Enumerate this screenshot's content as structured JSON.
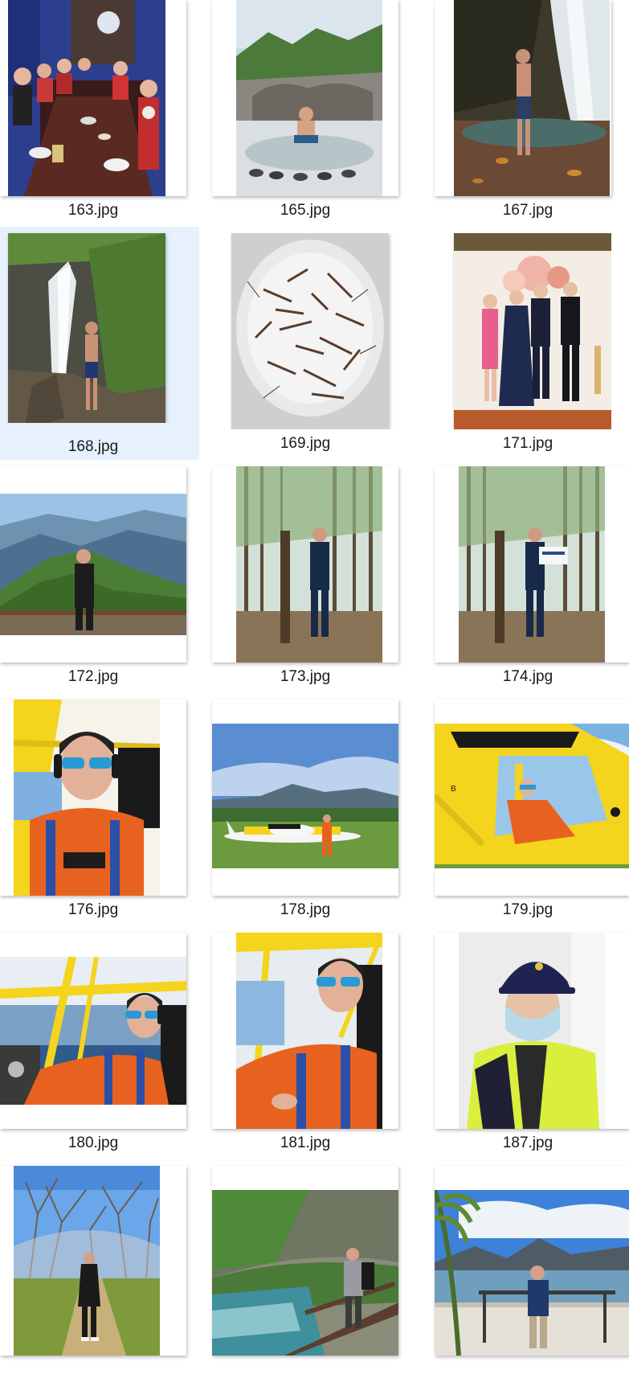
{
  "files": [
    {
      "name": "163.jpg",
      "scene": "restaurant-dinner",
      "selected": false
    },
    {
      "name": "165.jpg",
      "scene": "hot-spring",
      "selected": false
    },
    {
      "name": "167.jpg",
      "scene": "waterfall-pool",
      "selected": false
    },
    {
      "name": "168.jpg",
      "scene": "waterfall-cliff",
      "selected": true
    },
    {
      "name": "169.jpg",
      "scene": "shrimp-bucket",
      "selected": false
    },
    {
      "name": "171.jpg",
      "scene": "wedding-group",
      "selected": false
    },
    {
      "name": "172.jpg",
      "scene": "mountain-view",
      "selected": false
    },
    {
      "name": "173.jpg",
      "scene": "forest-summit-marker",
      "selected": false
    },
    {
      "name": "174.jpg",
      "scene": "forest-summit-sign",
      "selected": false
    },
    {
      "name": "176.jpg",
      "scene": "pilot-selfie",
      "selected": false
    },
    {
      "name": "178.jpg",
      "scene": "plane-on-grass",
      "selected": false
    },
    {
      "name": "179.jpg",
      "scene": "yellow-plane-cockpit",
      "selected": false
    },
    {
      "name": "180.jpg",
      "scene": "pilot-flight-ocean",
      "selected": false
    },
    {
      "name": "181.jpg",
      "scene": "pilot-cockpit",
      "selected": false
    },
    {
      "name": "187.jpg",
      "scene": "cap-mask-portrait",
      "selected": false
    },
    {
      "name": "",
      "scene": "bare-trees-path",
      "selected": false
    },
    {
      "name": "",
      "scene": "river-gorge",
      "selected": false
    },
    {
      "name": "",
      "scene": "bay-island-view",
      "selected": false
    }
  ],
  "colors": {
    "selection": "#e6f1fd",
    "pilot_orange": "#e8621f",
    "plane_yellow": "#f4d41c",
    "sky_blue": "#8fc0ee"
  }
}
